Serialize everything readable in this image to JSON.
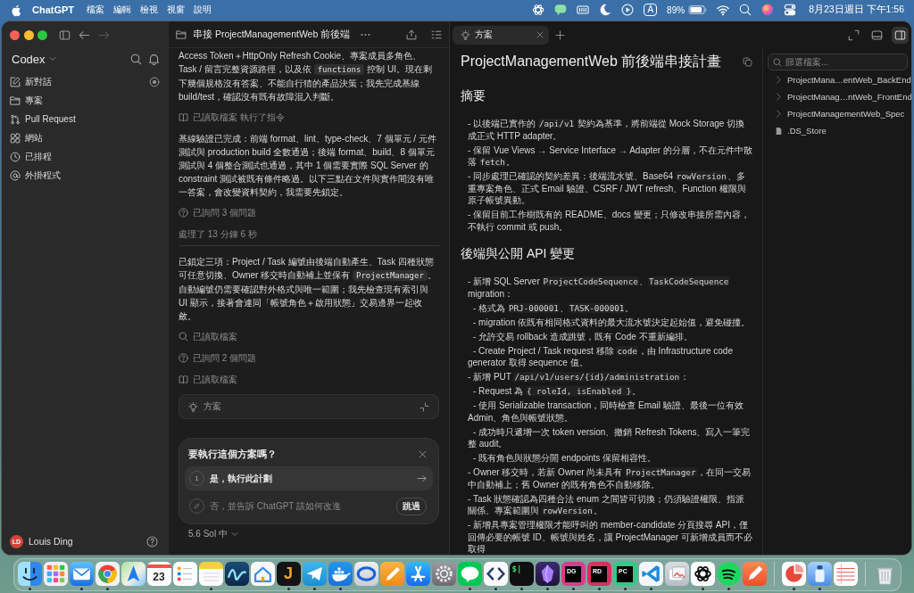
{
  "menu_bar": {
    "app_name": "ChatGPT",
    "menus": [
      "檔案",
      "編輯",
      "檢視",
      "視窗",
      "說明"
    ],
    "input_source": "A",
    "battery_percent": "89%",
    "clock": "8月23日週日 下午1:56"
  },
  "sidebar": {
    "history": [
      {
        "kind": "back",
        "disabled": false
      },
      {
        "kind": "forward",
        "disabled": true
      }
    ],
    "workspace": "Codex",
    "nav": [
      {
        "kind": "compose",
        "label": "新對話",
        "selected": false
      },
      {
        "kind": "folder",
        "label": "專案",
        "selected": false
      },
      {
        "kind": "pull-request",
        "label": "Pull Request",
        "selected": false
      },
      {
        "kind": "grid",
        "label": "網站",
        "selected": false
      },
      {
        "kind": "clock",
        "label": "已排程",
        "selected": false
      },
      {
        "kind": "at",
        "label": "外掛程式",
        "selected": false
      }
    ],
    "user": {
      "initials": "LD",
      "name": "Louis Ding"
    }
  },
  "thread": {
    "title": "串接 ProjectManagementWeb 前後端",
    "items": [
      {
        "kind": "paragraph",
        "segments": [
          {
            "kind": "text",
            "text": "Access Token＋HttpOnly Refresh Cookie、專案成員多角色、Task / 留言完整資源路徑，以及依 "
          },
          {
            "kind": "code",
            "text": "functions"
          },
          {
            "kind": "text",
            "text": " 控制 UI。現在剩下幾個規格沒有答案、不能自行猜的產品決策；我先完成基線 build/test，確認沒有既有故障混入判斷。"
          }
        ]
      },
      {
        "kind": "files",
        "text": "已讀取檔案 執行了指令"
      },
      {
        "kind": "paragraph",
        "segments": [
          {
            "kind": "text",
            "text": "基線驗證已完成：前端 format、lint、type-check、7 個單元 / 元件測試與 production build 全數通過；後端 format、build、8 個單元測試與 4 個整合測試也通過，其中 1 個需要實際 SQL Server 的 constraint 測試被既有條件略過。以下三點在文件與實作間沒有唯一答案，會改變資料契約，我需要先鎖定。"
          }
        ]
      },
      {
        "kind": "questions",
        "text": "已詢問 3 個問題"
      },
      {
        "kind": "duration",
        "text": "處理了 13 分鐘 6 秒"
      },
      {
        "kind": "paragraph",
        "segments": [
          {
            "kind": "text",
            "text": "已鎖定三項：Project / Task 編號由後端自動產生、Task 四種狀態可任意切換、Owner 移交時自動補上並保有 "
          },
          {
            "kind": "code",
            "text": "ProjectManager"
          },
          {
            "kind": "text",
            "text": "。自動編號仍需要確認對外格式與唯一範圍；我先檢查現有索引與 UI 顯示，接著會連同「帳號角色＋啟用狀態」交易邊界一起收斂。"
          }
        ]
      },
      {
        "kind": "search",
        "text": "已讀取檔案"
      },
      {
        "kind": "questions",
        "text": "已詢問 2 個問題"
      },
      {
        "kind": "files",
        "text": "已讀取檔案"
      }
    ],
    "plan_card": {
      "label": "方案"
    },
    "prompt": {
      "question": "要執行這個方案嗎？",
      "options": [
        {
          "kind": "choice",
          "number": "1",
          "label": "是，執行此計劃",
          "selected": true
        },
        {
          "kind": "input",
          "placeholder": "否，並告訴 ChatGPT 該如何改進",
          "action": "跳過",
          "selected": false
        }
      ]
    },
    "model": "5.6 Sol 中"
  },
  "plan_panel": {
    "tabs": [
      {
        "label": "方案",
        "selected": true
      }
    ],
    "file_pane_toggle": {
      "on": true
    },
    "document": {
      "title": "ProjectManagementWeb 前後端串接計畫",
      "sections": [
        {
          "heading": "摘要",
          "items": [
            {
              "segments": [
                {
                  "kind": "text",
                  "text": "- 以後端已實作的 "
                },
                {
                  "kind": "code",
                  "text": "/api/v1"
                },
                {
                  "kind": "text",
                  "text": " 契約為基準，將前端從 Mock Storage 切換成正式 HTTP adapter。"
                }
              ]
            },
            {
              "segments": [
                {
                  "kind": "text",
                  "text": "- 保留 Vue Views → Service Interface → Adapter 的分層，不在元件中散落 "
                },
                {
                  "kind": "code",
                  "text": "fetch"
                },
                {
                  "kind": "text",
                  "text": "。"
                }
              ]
            },
            {
              "segments": [
                {
                  "kind": "text",
                  "text": "- 同步處理已確認的契約差異：後端流水號、Base64 "
                },
                {
                  "kind": "code",
                  "text": "rowVersion"
                },
                {
                  "kind": "text",
                  "text": "、多重專案角色、正式 Email 驗證、CSRF / JWT refresh、Function 權限與原子帳號異動。"
                }
              ]
            },
            {
              "segments": [
                {
                  "kind": "text",
                  "text": "- 保留目前工作樹既有的 README、docs 變更；只修改串接所需內容，不執行 commit 或 push。"
                }
              ]
            }
          ]
        },
        {
          "heading": "後端與公開 API 變更",
          "items": [
            {
              "segments": [
                {
                  "kind": "text",
                  "text": "- 新增 SQL Server "
                },
                {
                  "kind": "code",
                  "text": "ProjectCodeSequence"
                },
                {
                  "kind": "text",
                  "text": "、"
                },
                {
                  "kind": "code",
                  "text": "TaskCodeSequence"
                },
                {
                  "kind": "text",
                  "text": " migration："
                }
              ],
              "children": [
                {
                  "segments": [
                    {
                      "kind": "text",
                      "text": "- 格式為 "
                    },
                    {
                      "kind": "code",
                      "text": "PRJ-000001"
                    },
                    {
                      "kind": "text",
                      "text": "、"
                    },
                    {
                      "kind": "code",
                      "text": "TASK-000001"
                    },
                    {
                      "kind": "text",
                      "text": "。"
                    }
                  ]
                },
                {
                  "segments": [
                    {
                      "kind": "text",
                      "text": "- migration 依既有相同格式資料的最大流水號決定起始值，避免碰撞。"
                    }
                  ]
                },
                {
                  "segments": [
                    {
                      "kind": "text",
                      "text": "- 允許交易 rollback 造成跳號，既有 Code 不重新編排。"
                    }
                  ]
                },
                {
                  "segments": [
                    {
                      "kind": "text",
                      "text": "- Create Project / Task request 移除 "
                    },
                    {
                      "kind": "code",
                      "text": "code"
                    },
                    {
                      "kind": "text",
                      "text": "，由 Infrastructure code generator 取得 sequence 值。"
                    }
                  ]
                }
              ]
            },
            {
              "segments": [
                {
                  "kind": "text",
                  "text": "- 新增 PUT "
                },
                {
                  "kind": "code",
                  "text": "/api/v1/users/{id}/administration"
                },
                {
                  "kind": "text",
                  "text": "："
                }
              ],
              "children": [
                {
                  "segments": [
                    {
                      "kind": "text",
                      "text": "- Request 為 "
                    },
                    {
                      "kind": "code",
                      "text": "{ roleId, isEnabled }"
                    },
                    {
                      "kind": "text",
                      "text": "。"
                    }
                  ]
                },
                {
                  "segments": [
                    {
                      "kind": "text",
                      "text": "- 使用 Serializable transaction，同時檢查 Email 驗證、最後一位有效 Admin、角色與帳號狀態。"
                    }
                  ]
                },
                {
                  "segments": [
                    {
                      "kind": "text",
                      "text": "- 成功時只遞增一次 token version、撤銷 Refresh Tokens、寫入一筆完整 audit。"
                    }
                  ]
                },
                {
                  "segments": [
                    {
                      "kind": "text",
                      "text": "- 既有角色與狀態分開 endpoints 保留相容性。"
                    }
                  ]
                }
              ]
            },
            {
              "segments": [
                {
                  "kind": "text",
                  "text": "- Owner 移交時，若新 Owner 尚未具有 "
                },
                {
                  "kind": "code",
                  "text": "ProjectManager"
                },
                {
                  "kind": "text",
                  "text": "，在同一交易中自動補上；舊 Owner 的既有角色不自動移除。"
                }
              ]
            },
            {
              "segments": [
                {
                  "kind": "text",
                  "text": "- Task 狀態確認為四種合法 enum 之間皆可切換；仍須驗證權限、指派關係、專案範圍與 "
                },
                {
                  "kind": "code",
                  "text": "rowVersion"
                },
                {
                  "kind": "text",
                  "text": "。"
                }
              ]
            },
            {
              "segments": [
                {
                  "kind": "text",
                  "text": "- 新增具專案管理權限才能呼叫的 member-candidate 分頁搜尋 API，僅回傳必要的帳號 ID、帳號與姓名，讓 ProjectManager 可新增成員而不必取得"
                }
              ]
            }
          ]
        }
      ]
    },
    "file_pane": {
      "filter": {
        "placeholder": "篩選檔案..."
      },
      "entries": [
        {
          "kind": "folder",
          "name": "ProjectMana…entWeb_BackEnd",
          "expanded": false
        },
        {
          "kind": "folder",
          "name": "ProjectManag…ntWeb_FrontEnd",
          "expanded": false
        },
        {
          "kind": "folder",
          "name": "ProjectManagementWeb_Spec",
          "expanded": false
        },
        {
          "kind": "file",
          "name": ".DS_Store"
        }
      ]
    }
  },
  "dock": {
    "apps": [
      {
        "kind": "face",
        "running": true
      },
      {
        "kind": "grid",
        "running": false
      },
      {
        "kind": "envelope",
        "running": true
      },
      {
        "kind": "browser",
        "running": true
      },
      {
        "kind": "map",
        "running": false
      },
      {
        "kind": "calendar",
        "label": "23",
        "running": false
      },
      {
        "kind": "checklist",
        "running": false
      },
      {
        "kind": "notepad",
        "running": true
      },
      {
        "kind": "wave",
        "running": false
      },
      {
        "kind": "house",
        "running": false
      },
      {
        "kind": "letter",
        "label": "J",
        "running": true
      },
      {
        "kind": "plane",
        "running": true
      },
      {
        "kind": "whale",
        "running": true
      },
      {
        "kind": "ring",
        "running": false
      },
      {
        "kind": "pencil",
        "running": false
      },
      {
        "kind": "sticks",
        "running": false
      },
      {
        "kind": "gear",
        "running": false
      },
      {
        "kind": "bubble",
        "running": true
      },
      {
        "kind": "brackets",
        "running": true
      },
      {
        "kind": "terminal",
        "label": "$|",
        "running": true
      },
      {
        "kind": "crystal",
        "running": true
      },
      {
        "kind": "monogram",
        "label": "DG",
        "color": "#d23f8f",
        "running": true
      },
      {
        "kind": "monogram",
        "label": "RD",
        "color": "#d8305f",
        "running": true
      },
      {
        "kind": "monogram",
        "label": "PC",
        "color": "#32c987",
        "running": true
      },
      {
        "kind": "ribbon",
        "running": true
      },
      {
        "kind": "photos",
        "running": false
      },
      {
        "kind": "knot",
        "running": true
      },
      {
        "kind": "arcs",
        "running": true
      },
      {
        "kind": "pen",
        "running": false
      }
    ],
    "recent": [
      {
        "kind": "swirl",
        "running": true
      },
      {
        "kind": "bottle",
        "running": true
      },
      {
        "kind": "page",
        "running": false
      }
    ]
  }
}
